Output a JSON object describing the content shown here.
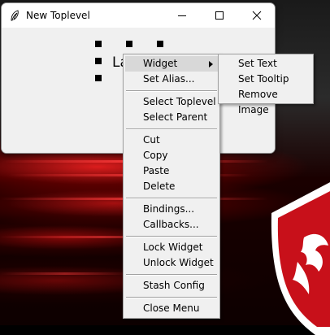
{
  "window": {
    "title": "New Toplevel",
    "icon": "feather-icon",
    "controls": [
      "minimize-icon",
      "maximize-icon",
      "close-icon"
    ]
  },
  "canvas": {
    "widget_label": "La"
  },
  "context_menu": {
    "items": [
      {
        "label": "Widget",
        "has_submenu": true,
        "active": true
      },
      {
        "label": "Set Alias..."
      },
      {
        "label": "Select Toplevel"
      },
      {
        "label": "Select Parent"
      },
      {
        "label": "Cut"
      },
      {
        "label": "Copy"
      },
      {
        "label": "Paste"
      },
      {
        "label": "Delete"
      },
      {
        "label": "Bindings..."
      },
      {
        "label": "Callbacks..."
      },
      {
        "label": "Lock Widget"
      },
      {
        "label": "Unlock Widget"
      },
      {
        "label": "Stash Config"
      },
      {
        "label": "Close Menu"
      }
    ]
  },
  "submenu": {
    "items": [
      {
        "label": "Set Text"
      },
      {
        "label": "Set Tooltip"
      },
      {
        "label": "Remove Image"
      }
    ]
  },
  "colors": {
    "menu_bg": "#f0f0f0",
    "menu_highlight": "#d8d8d8",
    "wallpaper_accent": "#e01e1e"
  }
}
